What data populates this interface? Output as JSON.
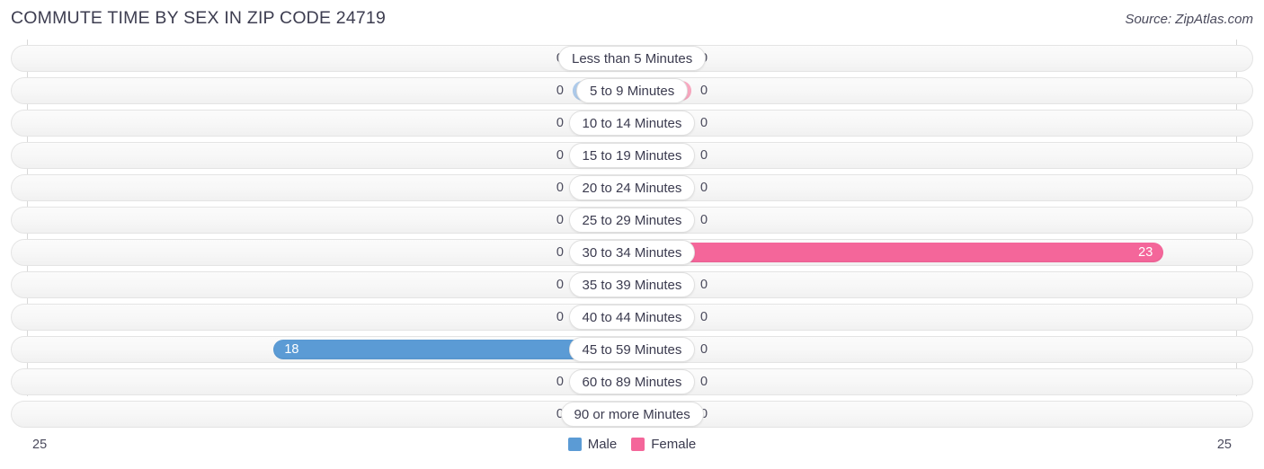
{
  "header": {
    "title": "COMMUTE TIME BY SEX IN ZIP CODE 24719",
    "source": "Source: ZipAtlas.com"
  },
  "axis": {
    "left_tick": "25",
    "right_tick": "25"
  },
  "legend": {
    "items": [
      {
        "label": "Male",
        "color": "#5b9bd5"
      },
      {
        "label": "Female",
        "color": "#f4669a"
      }
    ]
  },
  "colors": {
    "male_light": "#aecbeb",
    "male_strong": "#5b9bd5",
    "female_light": "#f9a8c0",
    "female_strong": "#f4669a",
    "track": "#f7f7f7",
    "pill": "#ffffff"
  },
  "chart_data": {
    "type": "bar",
    "title": "COMMUTE TIME BY SEX IN ZIP CODE 24719",
    "subtitle": "Source: ZipAtlas.com",
    "orientation": "horizontal-diverging",
    "xlabel": "",
    "ylabel": "",
    "xlim": [
      25,
      25
    ],
    "axis_max_left": 25,
    "axis_max_right": 25,
    "grid": false,
    "legend_position": "bottom-center",
    "categories": [
      "Less than 5 Minutes",
      "5 to 9 Minutes",
      "10 to 14 Minutes",
      "15 to 19 Minutes",
      "20 to 24 Minutes",
      "25 to 29 Minutes",
      "30 to 34 Minutes",
      "35 to 39 Minutes",
      "40 to 44 Minutes",
      "45 to 59 Minutes",
      "60 to 89 Minutes",
      "90 or more Minutes"
    ],
    "series": [
      {
        "name": "Male",
        "color": "#5b9bd5",
        "side": "left",
        "values": [
          0,
          0,
          0,
          0,
          0,
          0,
          0,
          0,
          0,
          18,
          0,
          0
        ]
      },
      {
        "name": "Female",
        "color": "#f4669a",
        "side": "right",
        "values": [
          0,
          0,
          0,
          0,
          0,
          0,
          23,
          0,
          0,
          0,
          0,
          0
        ]
      }
    ]
  },
  "rows": [
    {
      "label": "Less than 5 Minutes",
      "male": "0",
      "female": "0"
    },
    {
      "label": "5 to 9 Minutes",
      "male": "0",
      "female": "0"
    },
    {
      "label": "10 to 14 Minutes",
      "male": "0",
      "female": "0"
    },
    {
      "label": "15 to 19 Minutes",
      "male": "0",
      "female": "0"
    },
    {
      "label": "20 to 24 Minutes",
      "male": "0",
      "female": "0"
    },
    {
      "label": "25 to 29 Minutes",
      "male": "0",
      "female": "0"
    },
    {
      "label": "30 to 34 Minutes",
      "male": "0",
      "female": "23"
    },
    {
      "label": "35 to 39 Minutes",
      "male": "0",
      "female": "0"
    },
    {
      "label": "40 to 44 Minutes",
      "male": "0",
      "female": "0"
    },
    {
      "label": "45 to 59 Minutes",
      "male": "18",
      "female": "0"
    },
    {
      "label": "60 to 89 Minutes",
      "male": "0",
      "female": "0"
    },
    {
      "label": "90 or more Minutes",
      "male": "0",
      "female": "0"
    }
  ]
}
